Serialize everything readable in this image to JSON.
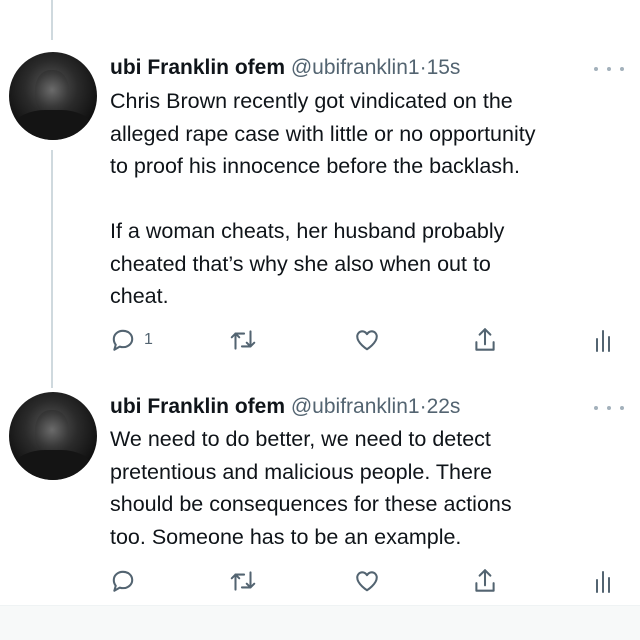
{
  "tweets": [
    {
      "name": "ubi Franklin ofem",
      "handle": "@ubifranklin1",
      "separator": "·",
      "time": "15s",
      "paragraphs": [
        [
          "Chris Brown recently got vindicated on the",
          "alleged rape case with little or no opportunity",
          "to proof his innocence before the backlash."
        ],
        [
          "If a woman cheats, her husband probably",
          "cheated that’s why she also when out to",
          "cheat."
        ]
      ],
      "reply_count": "1"
    },
    {
      "name": "ubi Franklin ofem",
      "handle": "@ubifranklin1",
      "separator": "·",
      "time": "22s",
      "paragraphs": [
        [
          "We need to do better, we need to detect",
          "pretentious and malicious people. There",
          "should be consequences for these actions",
          "too. Someone has to be an example."
        ]
      ],
      "reply_count": ""
    }
  ],
  "icons": {
    "reply": "speech-bubble-outline",
    "retweet": "retweet-arrows",
    "like": "heart-outline",
    "share": "upload-arrow",
    "analytics": "bar-chart"
  },
  "colors": {
    "text": "#0f1419",
    "secondary": "#536471",
    "icon": "#536471",
    "thread_line": "#cfd9de"
  }
}
